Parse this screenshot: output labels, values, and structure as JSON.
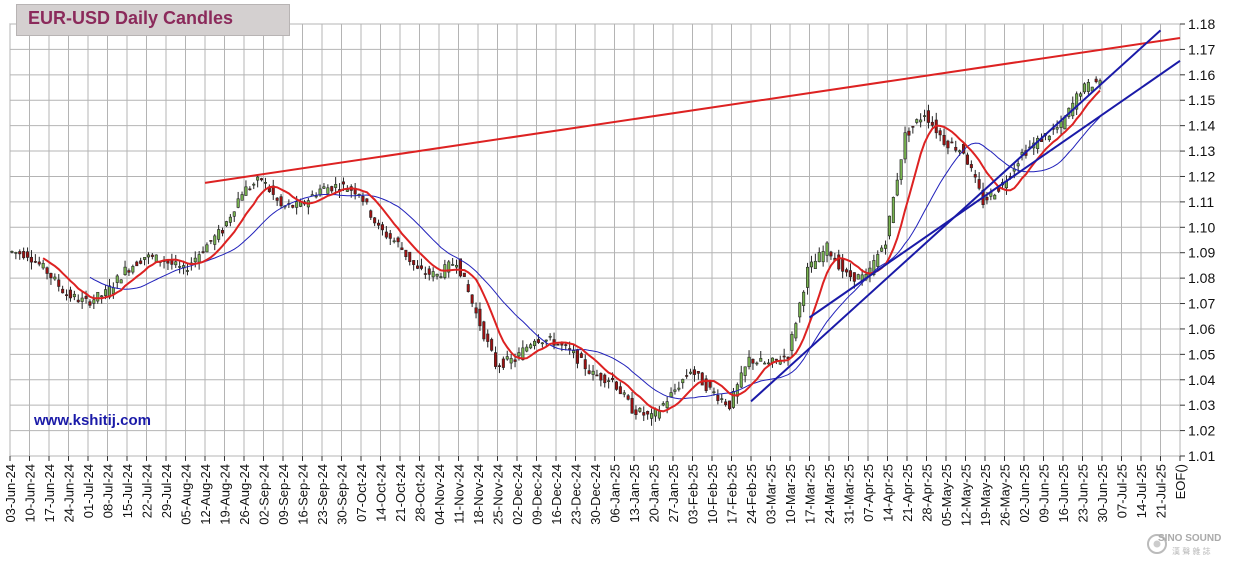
{
  "title": "EUR-USD Daily  Candles",
  "website": "www.kshitij.com",
  "watermark": {
    "brand": "SINO SOUND",
    "sub": "漢 聲 雜 誌"
  },
  "chart_data": {
    "type": "candlestick",
    "title": "EUR-USD Daily  Candles",
    "xlabel": "",
    "ylabel": "",
    "ylim": [
      1.01,
      1.18
    ],
    "y_ticks": [
      1.01,
      1.02,
      1.03,
      1.04,
      1.05,
      1.06,
      1.07,
      1.08,
      1.09,
      1.1,
      1.11,
      1.12,
      1.13,
      1.14,
      1.15,
      1.16,
      1.17,
      1.18
    ],
    "x_tick_labels": [
      "03-Jun-24",
      "10-Jun-24",
      "17-Jun-24",
      "24-Jun-24",
      "01-Jul-24",
      "08-Jul-24",
      "15-Jul-24",
      "22-Jul-24",
      "29-Jul-24",
      "05-Aug-24",
      "12-Aug-24",
      "19-Aug-24",
      "26-Aug-24",
      "02-Sep-24",
      "09-Sep-24",
      "16-Sep-24",
      "23-Sep-24",
      "30-Sep-24",
      "07-Oct-24",
      "14-Oct-24",
      "21-Oct-24",
      "28-Oct-24",
      "04-Nov-24",
      "11-Nov-24",
      "18-Nov-24",
      "25-Nov-24",
      "02-Dec-24",
      "09-Dec-24",
      "16-Dec-24",
      "23-Dec-24",
      "30-Dec-24",
      "06-Jan-25",
      "13-Jan-25",
      "20-Jan-25",
      "27-Jan-25",
      "03-Feb-25",
      "10-Feb-25",
      "17-Feb-25",
      "24-Feb-25",
      "03-Mar-25",
      "10-Mar-25",
      "17-Mar-25",
      "24-Mar-25",
      "31-Mar-25",
      "07-Apr-25",
      "14-Apr-25",
      "21-Apr-25",
      "28-Apr-25",
      "05-May-25",
      "12-May-25",
      "19-May-25",
      "26-May-25",
      "02-Jun-25",
      "09-Jun-25",
      "16-Jun-25",
      "23-Jun-25",
      "30-Jun-25",
      "07-Jul-25",
      "14-Jul-25",
      "21-Jul-25",
      "EOF()"
    ],
    "weekly_closes": [
      1.0895,
      1.0825,
      1.0735,
      1.0705,
      1.074,
      1.083,
      1.0885,
      1.087,
      1.083,
      1.0915,
      1.099,
      1.114,
      1.119,
      1.108,
      1.1085,
      1.115,
      1.1165,
      1.114,
      1.0995,
      1.0935,
      1.083,
      1.081,
      1.087,
      1.066,
      1.046,
      1.048,
      1.0565,
      1.055,
      1.05,
      1.042,
      1.04,
      1.0285,
      1.025,
      1.034,
      1.044,
      1.036,
      1.03,
      1.048,
      1.046,
      1.05,
      1.083,
      1.092,
      1.081,
      1.08,
      1.095,
      1.136,
      1.145,
      1.134,
      1.13,
      1.11,
      1.117,
      1.129,
      1.135,
      1.14,
      1.154,
      1.158
    ],
    "series": [],
    "trendlines": {
      "resistance_red": {
        "color": "#dd2222",
        "from": [
          "12-Aug-24",
          1.1175
        ],
        "to": [
          "EOF()",
          1.1745
        ]
      },
      "support_blue_1": {
        "color": "#1a1aa8",
        "from": [
          "24-Feb-25",
          1.0315
        ],
        "to": [
          "21-Jul-25",
          1.1775
        ]
      },
      "support_blue_2": {
        "color": "#1a1aa8",
        "from": [
          "17-Mar-25",
          1.0645
        ],
        "to": [
          "EOF()",
          1.1655
        ]
      }
    },
    "colors": {
      "up": "#78b450",
      "down": "#a01010",
      "ma_fast": "#dd2222",
      "ma_slow": "#2222bb",
      "grid": "#b4b4b4",
      "title_text": "#8b2a5b",
      "website_text": "#1a1aa8"
    },
    "grid": true
  }
}
